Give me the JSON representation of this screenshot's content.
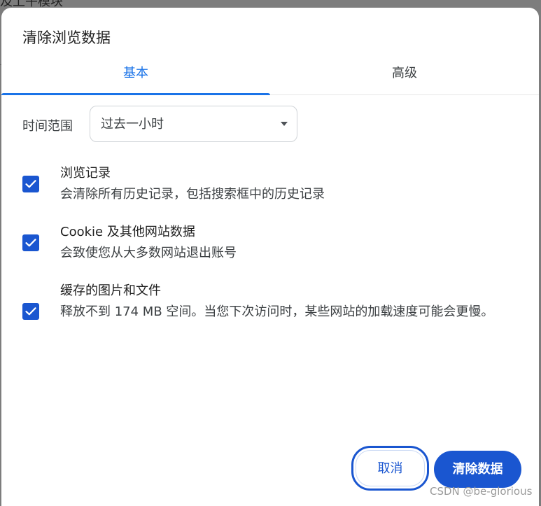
{
  "background": {
    "peek_text": "及上午模块"
  },
  "dialog": {
    "title": "清除浏览数据",
    "tabs": [
      {
        "label": "基本",
        "selected": true
      },
      {
        "label": "高级",
        "selected": false
      }
    ],
    "time_range": {
      "label": "时间范围",
      "selected": "过去一小时"
    },
    "options": [
      {
        "title": "浏览记录",
        "description": "会清除所有历史记录，包括搜索框中的历史记录",
        "checked": true
      },
      {
        "title": "Cookie 及其他网站数据",
        "description": "会致使您从大多数网站退出账号",
        "checked": true
      },
      {
        "title": "缓存的图片和文件",
        "description": "释放不到 174 MB 空间。当您下次访问时，某些网站的加载速度可能会更慢。",
        "checked": true
      }
    ],
    "buttons": {
      "cancel": "取消",
      "clear": "清除数据"
    }
  },
  "watermark": "CSDN @be-glorious",
  "colors": {
    "accent": "#1a73e8",
    "primary_button": "#1a56d0",
    "checkbox": "#1a56d0",
    "overlay": "#7d7d7d"
  }
}
